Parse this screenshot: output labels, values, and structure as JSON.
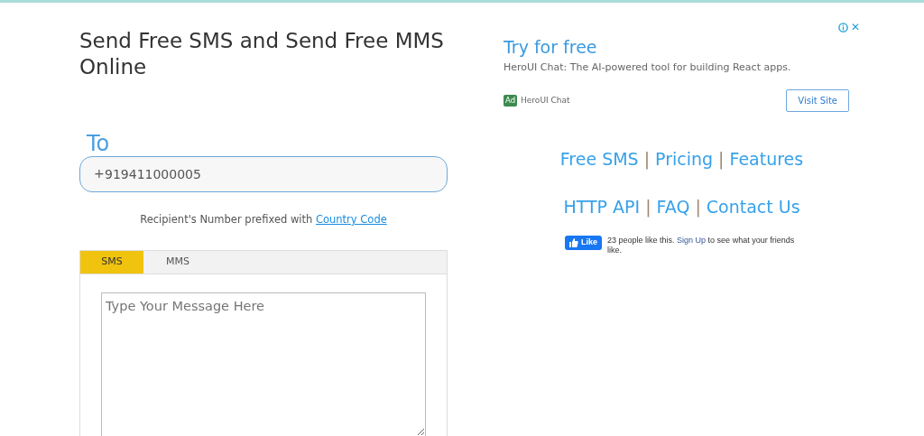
{
  "title": "Send Free SMS and Send Free MMS Online",
  "recipient": {
    "label": "To",
    "prefix": "+",
    "value": "919411000005",
    "hint": "Recipient's Number prefixed with ",
    "hint_link": "Country Code"
  },
  "tabs": [
    {
      "label": "SMS",
      "selected": true
    },
    {
      "label": "MMS",
      "selected": false
    }
  ],
  "message": {
    "placeholder": "Type Your Message Here"
  },
  "ad": {
    "headline": "Try for free",
    "text": "HeroUI Chat: The AI-powered tool for building React apps.",
    "badge": "Ad",
    "advertiser": "HeroUI Chat",
    "button": "Visit Site",
    "close": "✕"
  },
  "nav_rows": [
    [
      {
        "kind": "link",
        "text": "Free SMS"
      },
      {
        "kind": "separator",
        "text": "|"
      },
      {
        "kind": "link",
        "text": "Pricing"
      },
      {
        "kind": "separator",
        "text": "|"
      },
      {
        "kind": "link",
        "text": "Features"
      }
    ],
    [
      {
        "kind": "link",
        "text": "HTTP API"
      },
      {
        "kind": "separator",
        "text": "|"
      },
      {
        "kind": "link",
        "text": "FAQ"
      },
      {
        "kind": "separator",
        "text": "|"
      },
      {
        "kind": "link",
        "text": "Contact Us"
      }
    ]
  ],
  "like": {
    "button": "Like",
    "before": "23 people like this. ",
    "link": "Sign Up",
    "after": " to see what your friends like."
  }
}
